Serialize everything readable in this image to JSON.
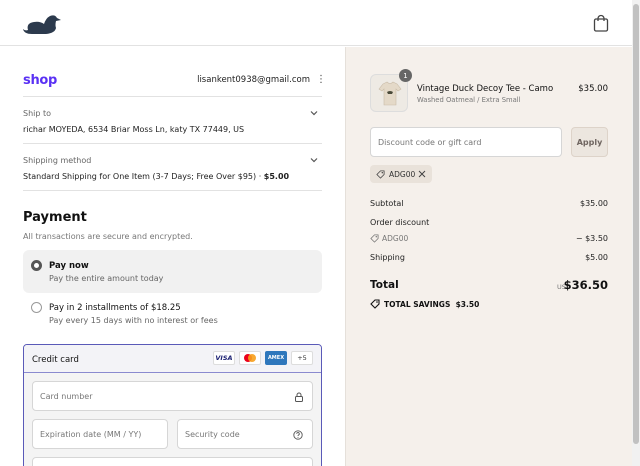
{
  "header": {
    "logo_icon": "duck-logo-icon",
    "cart_icon": "shopping-bag-icon"
  },
  "account": {
    "shop_label": "shop",
    "email": "lisankent0938@gmail.com",
    "menu_icon": "kebab-icon"
  },
  "ship_to": {
    "label": "Ship to",
    "value": "richar MOYEDA, 6534 Briar Moss Ln, katy TX 77449, US"
  },
  "shipping_method": {
    "label": "Shipping method",
    "value": "Standard Shipping for One Item (3-7 Days; Free Over $95)",
    "separator": "·",
    "price": "$5.00"
  },
  "payment": {
    "title": "Payment",
    "subtitle": "All transactions are secure and encrypted.",
    "options": [
      {
        "title": "Pay now",
        "desc": "Pay the entire amount today",
        "selected": true
      },
      {
        "title": "Pay in 2 installments of $18.25",
        "desc": "Pay every 15 days with no interest or fees",
        "selected": false
      }
    ],
    "card": {
      "title": "Credit card",
      "brands": [
        "VISA",
        "",
        "AMEX",
        "+5"
      ],
      "card_number_placeholder": "Card number",
      "expiration_placeholder": "Expiration date (MM / YY)",
      "security_placeholder": "Security code"
    }
  },
  "summary": {
    "product": {
      "qty": "1",
      "name": "Vintage Duck Decoy Tee - Camo",
      "variant": "Washed Oatmeal / Extra Small",
      "price": "$35.00"
    },
    "discount_placeholder": "Discount code or gift card",
    "apply_label": "Apply",
    "applied_code": "ADG00",
    "subtotal_label": "Subtotal",
    "subtotal_value": "$35.00",
    "order_discount_label": "Order discount",
    "order_discount_code": "ADG00",
    "order_discount_value": "− $3.50",
    "shipping_label": "Shipping",
    "shipping_value": "$5.00",
    "total_label": "Total",
    "total_currency": "USD",
    "total_value": "$36.50",
    "savings_label": "TOTAL SAVINGS",
    "savings_value": "$3.50"
  },
  "colors": {
    "shop_purple": "#5a31f4",
    "summary_bg": "#f5f0eb",
    "duck_navy": "#2c3a4d"
  }
}
